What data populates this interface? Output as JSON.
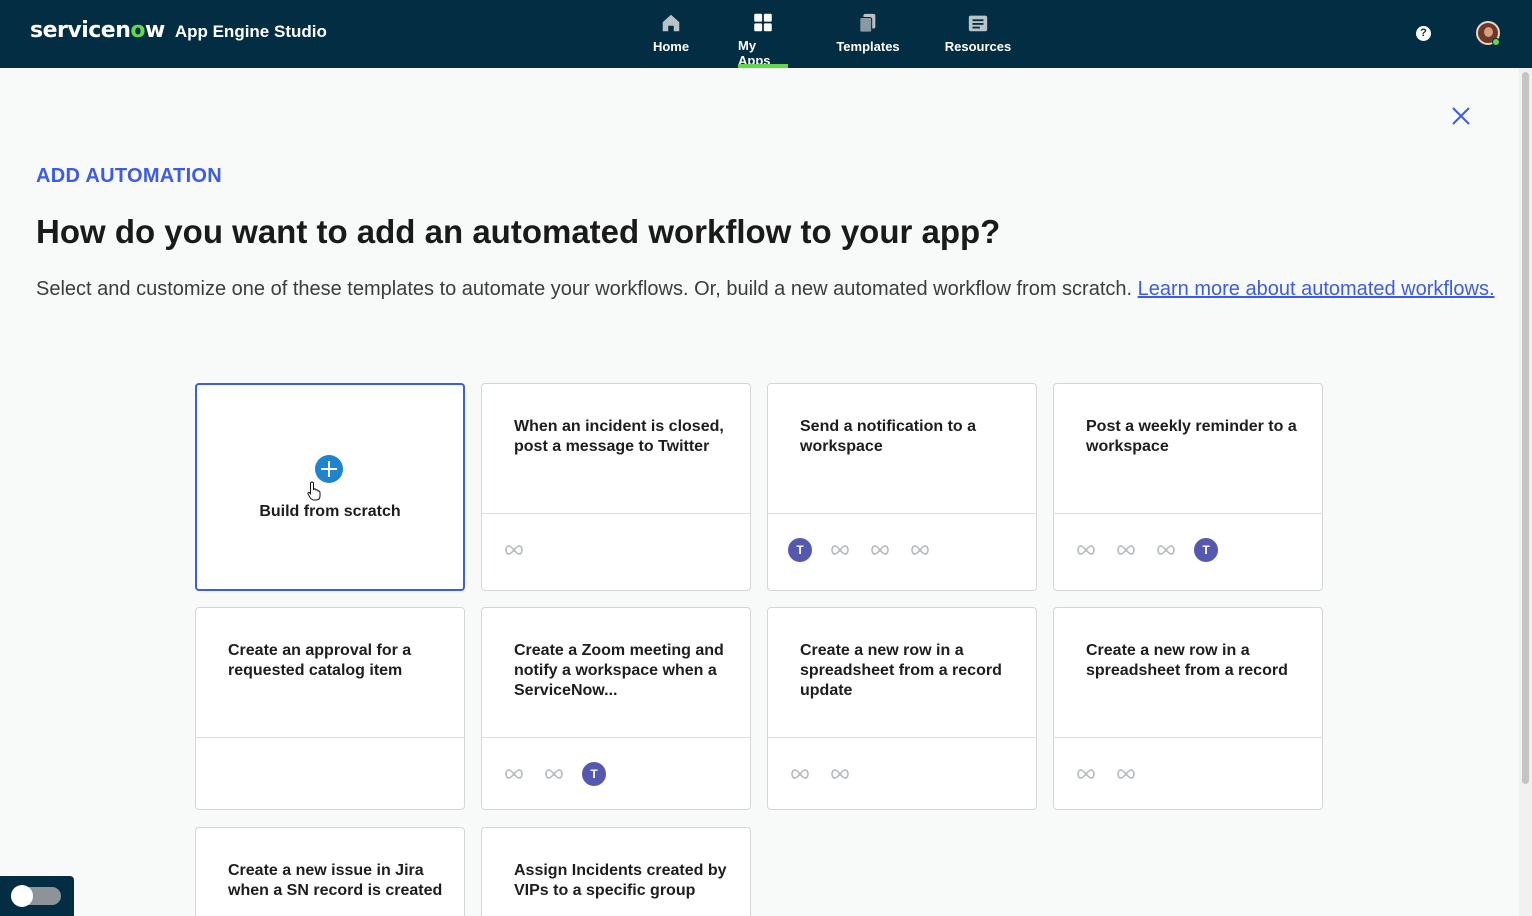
{
  "header": {
    "brand": "servicenow",
    "app_name": "App Engine Studio",
    "nav": [
      {
        "label": "Home",
        "icon": "home-icon"
      },
      {
        "label": "My Apps",
        "icon": "grid-icon",
        "active": true
      },
      {
        "label": "Templates",
        "icon": "templates-icon"
      },
      {
        "label": "Resources",
        "icon": "resources-icon"
      }
    ],
    "help_label": "?"
  },
  "page": {
    "eyebrow": "ADD AUTOMATION",
    "title": "How do you want to add an automated workflow to your app?",
    "description": "Select and customize one of these templates to automate your workflows. Or, build a new automated workflow from scratch. ",
    "learn_more_link": "Learn more about automated workflows."
  },
  "cards": [
    {
      "title": "Build from scratch",
      "type": "scratch",
      "selected": true
    },
    {
      "title": "When an incident is closed, post a message to Twitter",
      "icons": [
        "link-icon"
      ]
    },
    {
      "title": "Send a notification to a workspace",
      "icons": [
        "teams-icon",
        "link-icon",
        "link-icon",
        "link-icon"
      ]
    },
    {
      "title": "Post a weekly reminder to a workspace",
      "icons": [
        "link-icon",
        "link-icon",
        "link-icon",
        "teams-icon"
      ]
    },
    {
      "title": "Create an approval for a requested catalog item",
      "icons": []
    },
    {
      "title": "Create a Zoom meeting and notify a workspace when a ServiceNow...",
      "icons": [
        "link-icon",
        "link-icon",
        "teams-icon"
      ]
    },
    {
      "title": "Create a new row in a spreadsheet from a record update",
      "icons": [
        "link-icon",
        "link-icon"
      ]
    },
    {
      "title": "Create a new row in a spreadsheet from a record",
      "icons": [
        "link-icon",
        "link-icon"
      ]
    },
    {
      "title": "Create a new issue in Jira when a SN record is created",
      "icons": []
    },
    {
      "title": "Assign Incidents created by VIPs to a specific group",
      "icons": []
    }
  ],
  "colors": {
    "header_bg": "#032d42",
    "accent_green": "#62d84e",
    "link_blue": "#3d5ce4",
    "plus_blue": "#1f83cf",
    "teams_purple": "#5558af"
  }
}
